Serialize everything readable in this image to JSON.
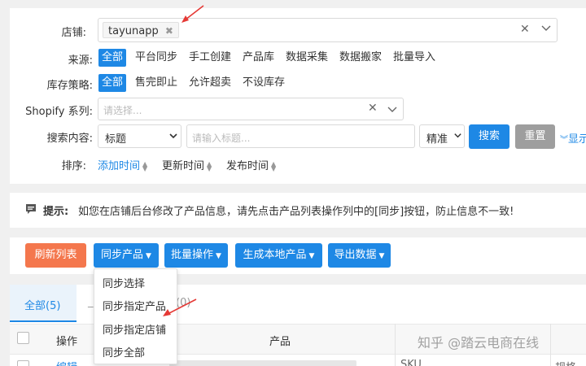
{
  "filters": {
    "store_label": "店铺:",
    "store_tag": "tayunapp",
    "source_label": "来源:",
    "source_options": [
      "全部",
      "平台同步",
      "手工创建",
      "产品库",
      "数据采集",
      "数据搬家",
      "批量导入"
    ],
    "stock_label": "库存策略:",
    "stock_options": [
      "全部",
      "售完即止",
      "允许超卖",
      "不设库存"
    ],
    "series_label": "Shopify 系列:",
    "series_placeholder": "请选择...",
    "search_label": "搜索内容:",
    "search_field_value": "标题",
    "search_placeholder": "请输入标题...",
    "match_value": "精准",
    "search_btn": "搜索",
    "reset_btn": "重置",
    "show_more": "显示",
    "sort_label": "排序:",
    "sort_options": [
      "添加时间",
      "更新时间",
      "发布时间"
    ]
  },
  "tip": {
    "title": "提示:",
    "text": "如您在店铺后台修改了产品信息，请先点击产品列表操作列中的[同步]按钮，防止信息不一致!"
  },
  "toolbar": {
    "refresh": "刷新列表",
    "sync": "同步产品",
    "batch": "批量操作",
    "generate": "生成本地产品",
    "export": "导出数据"
  },
  "sync_menu": [
    "同步选择",
    "同步指定产品",
    "同步指定店铺",
    "同步全部"
  ],
  "tabs": {
    "all": "全部(5)",
    "other_count": "(0)"
  },
  "table": {
    "col_action": "操作",
    "col_product": "产品",
    "row_action": "编辑",
    "row_sku": "SKU",
    "row_spec": "规格"
  },
  "watermark": "知乎 @踏云电商在线",
  "colors": {
    "accent": "#1e88e5",
    "orange": "#f4774d",
    "arrow_red": "#e53935"
  }
}
